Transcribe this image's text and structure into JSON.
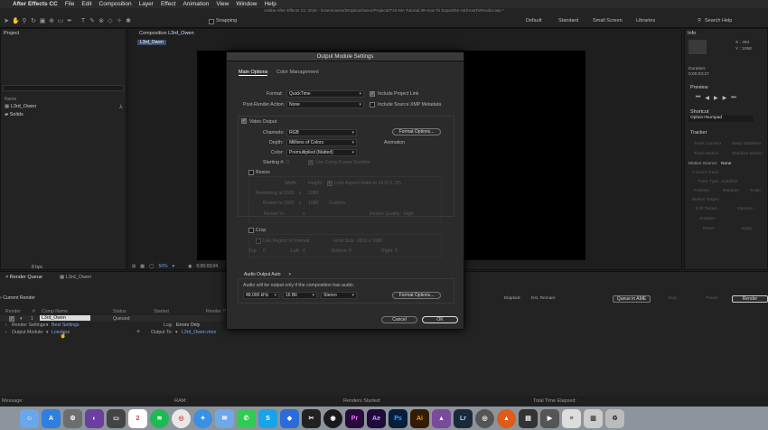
{
  "menubar": {
    "apple": "",
    "items": [
      "After Effects CC",
      "File",
      "Edit",
      "Composition",
      "Layer",
      "Effect",
      "Animation",
      "View",
      "Window",
      "Help"
    ],
    "path": "Adobe After Effects CC 2018 - /Users/owen/Dropbox/Owen/Projects/TJS-MA Tutorial 39-How To Export/02-AE/HowToRender.aep *"
  },
  "toolbar": {
    "snapping": "Snapping",
    "workspaces": [
      "Default",
      "Standard",
      "Small Screen",
      "Libraries"
    ],
    "search_help": "Search Help"
  },
  "project": {
    "title": "Project",
    "col_name": "Name",
    "items": [
      "L3rd_Owen",
      "Solids"
    ],
    "bpc": "8 bpc"
  },
  "composition": {
    "title": "Composition",
    "comp_name": "L3rd_Owen",
    "tab": "L3rd_Owen",
    "zoom": "50%",
    "timecode": "0;00;03;04"
  },
  "info": {
    "title": "Info",
    "x": "X : 494",
    "y": "Y : 1058",
    "duration_label": "Duration:",
    "duration": "0;00;03;27"
  },
  "preview": {
    "title": "Preview"
  },
  "shortcut": {
    "title": "Shortcut",
    "value": "Option+Numpad ."
  },
  "tracker": {
    "title": "Tracker",
    "buttons": [
      "Track Camera",
      "Warp Stabilizer",
      "Track Motion",
      "Stabilize Motion"
    ],
    "motion_source_label": "Motion Source:",
    "motion_source": "None",
    "current_track": "Current Track:",
    "track_type": "Track Type:",
    "track_type_value": "Stabilize",
    "position": "Position",
    "rotation": "Rotation",
    "scale": "Scale",
    "motion_target": "Motion Target:",
    "edit_target": "Edit Target...",
    "options": "Options...",
    "analyze": "Analyze:",
    "reset": "Reset",
    "apply": "Apply"
  },
  "dialog": {
    "title": "Output Module Settings",
    "tabs": [
      "Main Options",
      "Color Management"
    ],
    "format_label": "Format:",
    "format": "QuickTime",
    "include_project_link": "Include Project Link",
    "post_render_label": "Post-Render Action:",
    "post_render": "None",
    "include_xmp": "Include Source XMP Metadata",
    "video_output": "Video Output",
    "channels_label": "Channels:",
    "channels": "RGB",
    "depth_label": "Depth:",
    "depth": "Millions of Colors",
    "color_label": "Color:",
    "color": "Premultiplied (Matted)",
    "format_options": "Format Options...",
    "animation": "Animation",
    "starting_label": "Starting #:",
    "starting": "0",
    "use_comp_frame": "Use Comp Frame Number",
    "resize": "Resize",
    "width": "Width",
    "height": "Height",
    "lock_aspect": "Lock Aspect Ratio to 16:9 (1.78)",
    "rendering_at": "Rendering at:",
    "rendering_w": "1920",
    "rendering_h": "1080",
    "resize_to": "Resize to:",
    "resize_w": "1920",
    "resize_h": "1080",
    "custom": "Custom",
    "resize_pct": "Resize %:",
    "x": "x",
    "resize_quality": "Resize Quality:",
    "resize_quality_value": "High",
    "crop": "Crop",
    "use_roi": "Use Region of Interest",
    "final_size": "Final Size: 1920 x 1080",
    "top": "Top:",
    "left": "Left:",
    "bottom": "Bottom:",
    "right": "Right:",
    "crop_vals": [
      "0",
      "0",
      "0",
      "0"
    ],
    "audio_output": "Audio Output Auto",
    "audio_note": "Audio will be output only if the composition has audio.",
    "sample_rate": "48.000 kHz",
    "bit_depth": "16 Bit",
    "stereo": "Stereo",
    "audio_format_options": "Format Options...",
    "cancel": "Cancel",
    "ok": "OK"
  },
  "render_queue": {
    "tabs": [
      "Render Queue",
      "L3rd_Owen"
    ],
    "current_render": "Current Render",
    "elapsed": "Elapsed:",
    "est_remain": "Est. Remain:",
    "queue_ame": "Queue in AME",
    "stop": "Stop",
    "pause": "Pause",
    "render": "Render",
    "cols": [
      "Render",
      "#",
      "Comp Name",
      "Status",
      "Started",
      "Render Time"
    ],
    "row_num": "1",
    "row_comp": "L3rd_Owen",
    "row_status": "Queued",
    "render_settings_label": "Render Settings:",
    "render_settings": "Best Settings",
    "log_label": "Log:",
    "log": "Errors Only",
    "output_module_label": "Output Module:",
    "output_module": "Lossless",
    "output_to_label": "Output To:",
    "output_to": "L3rd_Owen.mov"
  },
  "statusbar": {
    "message": "Message:",
    "ram": "RAM:",
    "renders_started": "Renders Started:",
    "total_time": "Total Time Elapsed:"
  },
  "dock": {
    "calendar_day": "2",
    "apps": [
      "Pr",
      "Ae",
      "Ps",
      "Ai",
      "Lr"
    ]
  }
}
